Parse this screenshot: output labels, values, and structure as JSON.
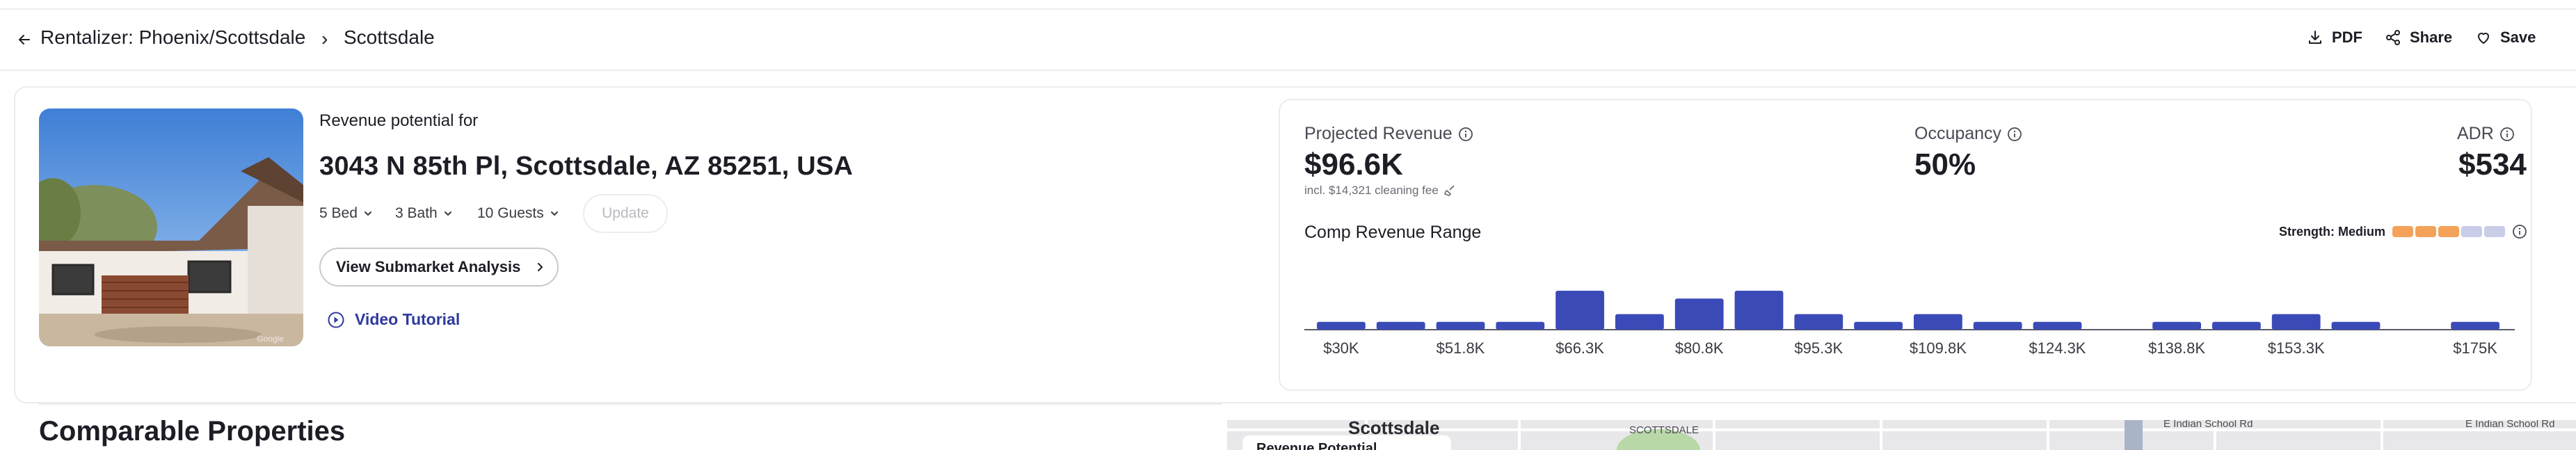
{
  "header": {
    "breadcrumb_root": "Rentalizer: Phoenix/Scottsdale",
    "breadcrumb_sep": "›",
    "breadcrumb_current": "Scottsdale",
    "actions": {
      "pdf": "PDF",
      "share": "Share",
      "save": "Save"
    }
  },
  "property": {
    "revenue_potential_label": "Revenue potential for",
    "address": "3043 N 85th Pl, Scottsdale, AZ 85251, USA",
    "bed": "5 Bed",
    "bath": "3 Bath",
    "guests": "10 Guests",
    "update_label": "Update",
    "submarket_label": "View Submarket Analysis",
    "video_label": "Video Tutorial",
    "photo_watermark": "Google"
  },
  "metrics": {
    "projected_revenue_label": "Projected Revenue",
    "projected_revenue_value": "$96.6K",
    "cleaning_note": "incl. $14,321 cleaning fee",
    "occupancy_label": "Occupancy",
    "occupancy_value": "50%",
    "adr_label": "ADR",
    "adr_value": "$534",
    "strength_label": "Strength: Medium",
    "strength_level": 3,
    "strength_total": 5
  },
  "chart_data": {
    "type": "bar",
    "title": "Comp Revenue Range",
    "tick_labels": [
      "$30K",
      "$51.8K",
      "$66.3K",
      "$80.8K",
      "$95.3K",
      "$109.8K",
      "$124.3K",
      "$138.8K",
      "$153.3K",
      "$175K"
    ],
    "values": [
      1,
      1,
      1,
      1,
      5,
      2,
      4,
      5,
      2,
      1,
      2,
      1,
      1,
      0,
      1,
      1,
      2,
      1,
      0,
      1
    ],
    "bar_color": "#3a4bb8"
  },
  "section": {
    "comparable_title": "Comparable Properties"
  },
  "map": {
    "title": "Scottsdale",
    "sub_label": "SCOTTSDALE",
    "road_1": "E Indian School Rd",
    "road_2": "E Indian School Rd",
    "card_label": "Revenue Potential"
  },
  "colors": {
    "accent": "#3a4bb8",
    "link": "#2f3a9e",
    "strength_on": "#f4a259",
    "strength_off": "#c9cde8"
  }
}
